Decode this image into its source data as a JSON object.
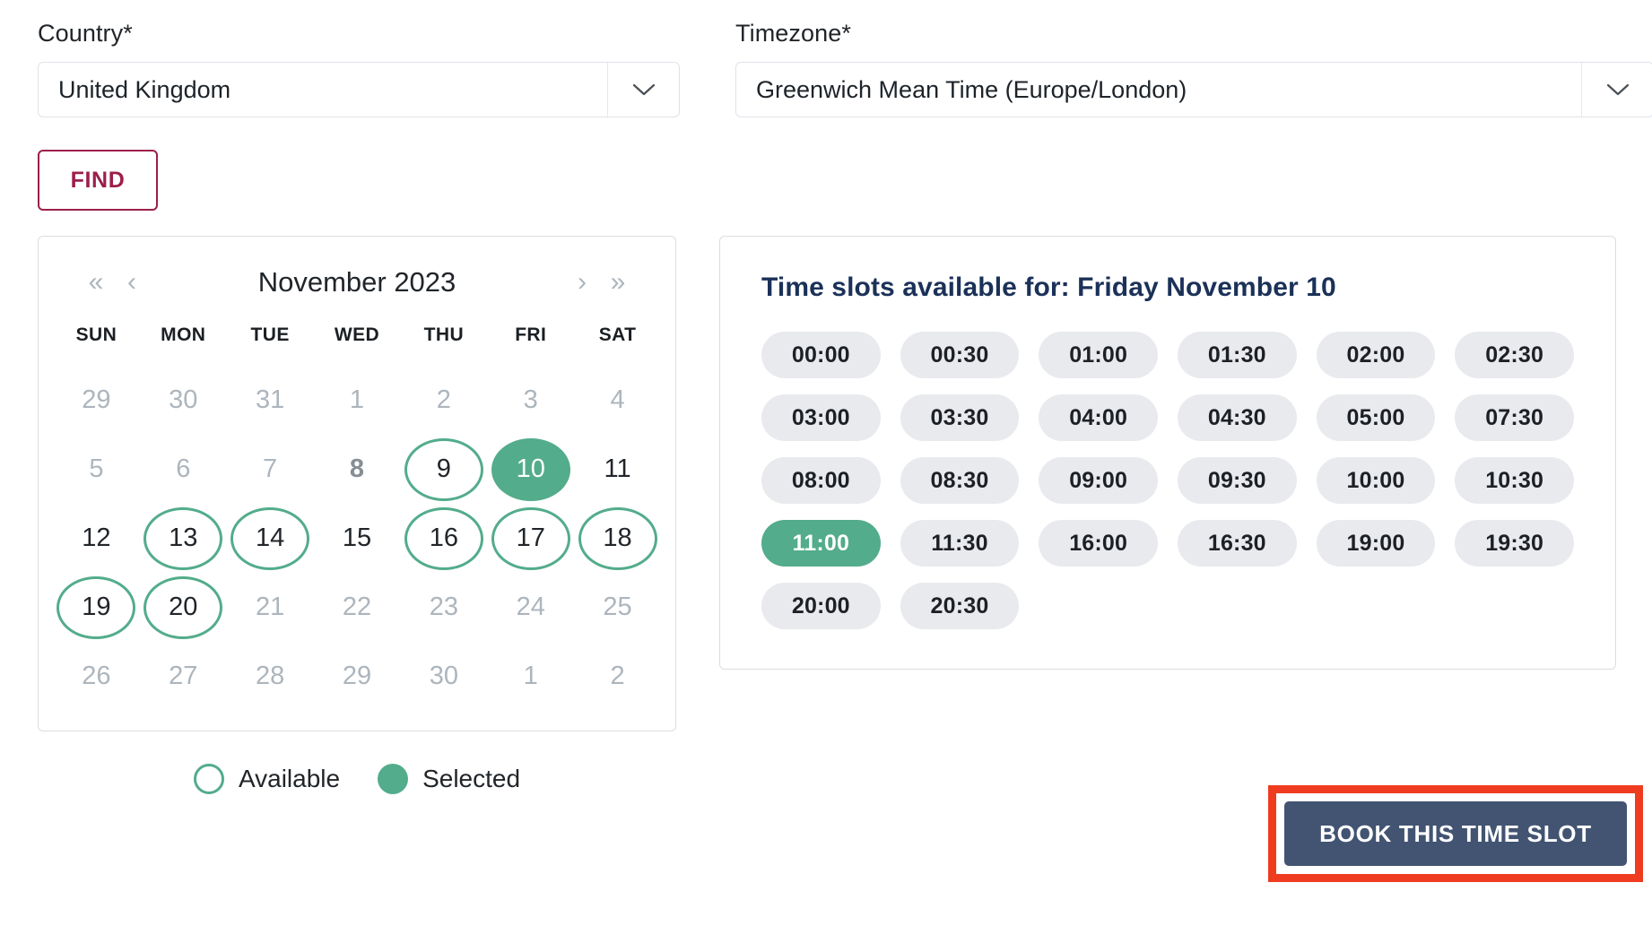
{
  "form": {
    "country": {
      "label": "Country*",
      "value": "United Kingdom",
      "icon": "chevron-down-icon"
    },
    "timezone": {
      "label": "Timezone*",
      "value": "Greenwich Mean Time (Europe/London)",
      "icon": "chevron-down-icon"
    },
    "find_button": "FIND"
  },
  "calendar": {
    "nav": {
      "prev_year": "«",
      "prev_month": "‹",
      "next_month": "›",
      "next_year": "»"
    },
    "title": "November 2023",
    "weekdays": [
      "SUN",
      "MON",
      "TUE",
      "WED",
      "THU",
      "FRI",
      "SAT"
    ],
    "weeks": [
      [
        {
          "label": "29",
          "state": "muted"
        },
        {
          "label": "30",
          "state": "muted"
        },
        {
          "label": "31",
          "state": "muted"
        },
        {
          "label": "1",
          "state": "muted"
        },
        {
          "label": "2",
          "state": "muted"
        },
        {
          "label": "3",
          "state": "muted"
        },
        {
          "label": "4",
          "state": "muted"
        }
      ],
      [
        {
          "label": "5",
          "state": "muted"
        },
        {
          "label": "6",
          "state": "muted"
        },
        {
          "label": "7",
          "state": "muted"
        },
        {
          "label": "8",
          "state": "today"
        },
        {
          "label": "9",
          "state": "avail"
        },
        {
          "label": "10",
          "state": "selected"
        },
        {
          "label": "11",
          "state": "plain"
        }
      ],
      [
        {
          "label": "12",
          "state": "plain"
        },
        {
          "label": "13",
          "state": "avail"
        },
        {
          "label": "14",
          "state": "avail"
        },
        {
          "label": "15",
          "state": "plain"
        },
        {
          "label": "16",
          "state": "avail"
        },
        {
          "label": "17",
          "state": "avail"
        },
        {
          "label": "18",
          "state": "avail"
        }
      ],
      [
        {
          "label": "19",
          "state": "avail"
        },
        {
          "label": "20",
          "state": "avail"
        },
        {
          "label": "21",
          "state": "muted"
        },
        {
          "label": "22",
          "state": "muted"
        },
        {
          "label": "23",
          "state": "muted"
        },
        {
          "label": "24",
          "state": "muted"
        },
        {
          "label": "25",
          "state": "muted"
        }
      ],
      [
        {
          "label": "26",
          "state": "muted"
        },
        {
          "label": "27",
          "state": "muted"
        },
        {
          "label": "28",
          "state": "muted"
        },
        {
          "label": "29",
          "state": "muted"
        },
        {
          "label": "30",
          "state": "muted"
        },
        {
          "label": "1",
          "state": "muted"
        },
        {
          "label": "2",
          "state": "muted"
        }
      ]
    ],
    "legend": [
      {
        "label": "Available",
        "style": "ring"
      },
      {
        "label": "Selected",
        "style": "fill"
      }
    ]
  },
  "slots": {
    "title": "Time slots available for: Friday November 10",
    "items": [
      {
        "label": "00:00",
        "selected": false
      },
      {
        "label": "00:30",
        "selected": false
      },
      {
        "label": "01:00",
        "selected": false
      },
      {
        "label": "01:30",
        "selected": false
      },
      {
        "label": "02:00",
        "selected": false
      },
      {
        "label": "02:30",
        "selected": false
      },
      {
        "label": "03:00",
        "selected": false
      },
      {
        "label": "03:30",
        "selected": false
      },
      {
        "label": "04:00",
        "selected": false
      },
      {
        "label": "04:30",
        "selected": false
      },
      {
        "label": "05:00",
        "selected": false
      },
      {
        "label": "07:30",
        "selected": false
      },
      {
        "label": "08:00",
        "selected": false
      },
      {
        "label": "08:30",
        "selected": false
      },
      {
        "label": "09:00",
        "selected": false
      },
      {
        "label": "09:30",
        "selected": false
      },
      {
        "label": "10:00",
        "selected": false
      },
      {
        "label": "10:30",
        "selected": false
      },
      {
        "label": "11:00",
        "selected": true
      },
      {
        "label": "11:30",
        "selected": false
      },
      {
        "label": "16:00",
        "selected": false
      },
      {
        "label": "16:30",
        "selected": false
      },
      {
        "label": "19:00",
        "selected": false
      },
      {
        "label": "19:30",
        "selected": false
      },
      {
        "label": "20:00",
        "selected": false
      },
      {
        "label": "20:30",
        "selected": false
      }
    ]
  },
  "book": {
    "label": "BOOK THIS TIME SLOT",
    "highlight_color": "#ef3c20"
  },
  "colors": {
    "green": "#53ac8b",
    "crimson": "#9c1f4c",
    "navy": "#1b3158",
    "slate": "#425472",
    "slot_bg": "#e9eaee"
  }
}
